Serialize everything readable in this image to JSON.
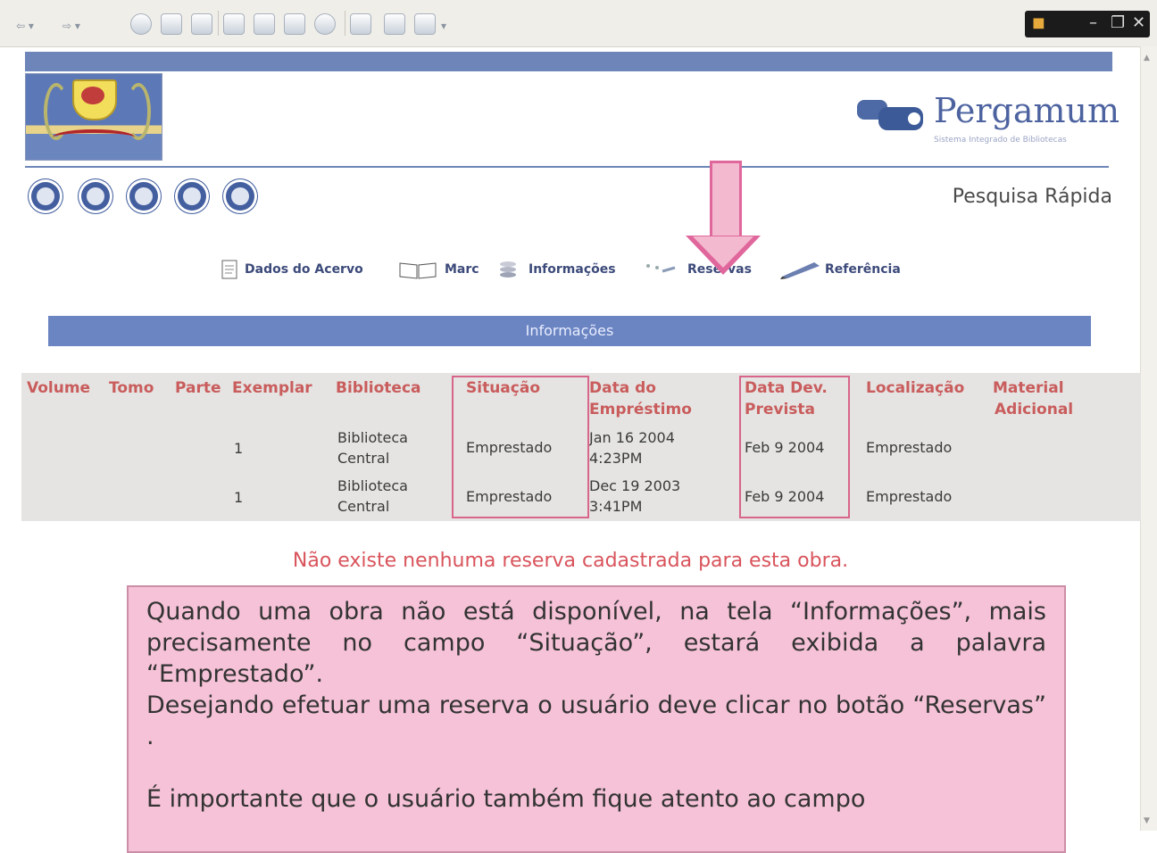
{
  "browser": {
    "title_glyphs": [
      "back",
      "forward",
      "stop",
      "refresh",
      "home",
      "search",
      "favorites",
      "history",
      "mail",
      "print",
      "edit"
    ]
  },
  "page": {
    "brand_name": "Pergamum",
    "brand_subtitle": "Sistema Integrado de Bibliotecas",
    "quick_search": "Pesquisa Rápida",
    "nav_buttons": [
      "back-icon",
      "clipboard-icon",
      "refresh-icon",
      "close-icon",
      "print-icon"
    ],
    "tabs": [
      {
        "label": "Dados do Acervo",
        "icon": "document-icon"
      },
      {
        "label": "Marc",
        "icon": "book-icon"
      },
      {
        "label": "Informações",
        "icon": "info-stack-icon"
      },
      {
        "label": "Reservas",
        "icon": "reserve-icon"
      },
      {
        "label": "Referência",
        "icon": "pen-icon"
      }
    ],
    "section_title": "Informações",
    "table": {
      "headers": {
        "volume": "Volume",
        "tomo": "Tomo",
        "parte": "Parte",
        "exemplar": "Exemplar",
        "biblioteca": "Biblioteca",
        "situacao": "Situação",
        "data_emprestimo_1": "Data do",
        "data_emprestimo_2": "Empréstimo",
        "data_dev_1": "Data Dev.",
        "data_dev_2": "Prevista",
        "localizacao": "Localização",
        "material_1": "Material",
        "material_2": "Adicional"
      },
      "rows": [
        {
          "exemplar": "1",
          "biblioteca_1": "Biblioteca",
          "biblioteca_2": "Central",
          "situacao": "Emprestado",
          "emprestimo_1": "Jan 16 2004",
          "emprestimo_2": "4:23PM",
          "data_dev": "Feb 9 2004",
          "localizacao": "Emprestado"
        },
        {
          "exemplar": "1",
          "biblioteca_1": "Biblioteca",
          "biblioteca_2": "Central",
          "situacao": "Emprestado",
          "emprestimo_1": "Dec 19 2003",
          "emprestimo_2": "3:41PM",
          "data_dev": "Feb 9 2004",
          "localizacao": "Emprestado"
        }
      ]
    },
    "no_reservation": "Não existe nenhuma reserva cadastrada para esta obra."
  },
  "note": {
    "p1": "Quando uma obra não está disponível, na tela “Informações”, mais precisamente  no campo “Situação”,  estará exibida a palavra “Emprestado”.",
    "p2": "Desejando efetuar uma reserva o usuário deve clicar no botão “Reservas” .",
    "p3": "É importante que o usuário também fique atento ao campo"
  },
  "colors": {
    "nav_blue": "#6d85b8",
    "header_red": "#c95c5c",
    "highlight_pink": "#e0679c",
    "note_bg": "#f6c2d7"
  }
}
